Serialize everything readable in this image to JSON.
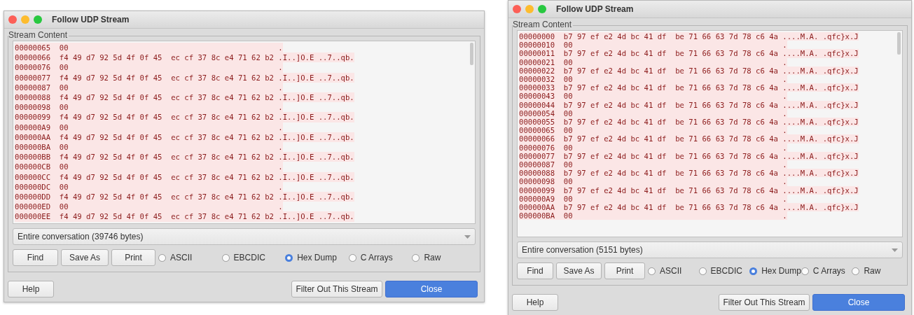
{
  "windows": [
    {
      "title": "Follow UDP Stream",
      "group_label": "Stream Content",
      "lines": [
        "00000065  00                                               .",
        "00000066  f4 49 d7 92 5d 4f 0f 45  ec cf 37 8c e4 71 62 b2 .I..]O.E ..7..qb.",
        "00000076  00                                               .",
        "00000077  f4 49 d7 92 5d 4f 0f 45  ec cf 37 8c e4 71 62 b2 .I..]O.E ..7..qb.",
        "00000087  00                                               .",
        "00000088  f4 49 d7 92 5d 4f 0f 45  ec cf 37 8c e4 71 62 b2 .I..]O.E ..7..qb.",
        "00000098  00                                               .",
        "00000099  f4 49 d7 92 5d 4f 0f 45  ec cf 37 8c e4 71 62 b2 .I..]O.E ..7..qb.",
        "000000A9  00                                               .",
        "000000AA  f4 49 d7 92 5d 4f 0f 45  ec cf 37 8c e4 71 62 b2 .I..]O.E ..7..qb.",
        "000000BA  00                                               .",
        "000000BB  f4 49 d7 92 5d 4f 0f 45  ec cf 37 8c e4 71 62 b2 .I..]O.E ..7..qb.",
        "000000CB  00                                               .",
        "000000CC  f4 49 d7 92 5d 4f 0f 45  ec cf 37 8c e4 71 62 b2 .I..]O.E ..7..qb.",
        "000000DC  00                                               .",
        "000000DD  f4 49 d7 92 5d 4f 0f 45  ec cf 37 8c e4 71 62 b2 .I..]O.E ..7..qb.",
        "000000ED  00                                               .",
        "000000EE  f4 49 d7 92 5d 4f 0f 45  ec cf 37 8c e4 71 62 b2 .I..]O.E ..7..qb."
      ],
      "conversation": "Entire conversation (39746 bytes)",
      "actions": [
        "Find",
        "Save As",
        "Print"
      ],
      "formats": [
        {
          "label": "ASCII",
          "selected": false
        },
        {
          "label": "EBCDIC",
          "selected": false
        },
        {
          "label": "Hex Dump",
          "selected": true
        },
        {
          "label": "C Arrays",
          "selected": false
        },
        {
          "label": "Raw",
          "selected": false
        }
      ],
      "footer": [
        {
          "label": "Help",
          "kind": "default"
        },
        {
          "label": "Filter Out This Stream",
          "kind": "default"
        },
        {
          "label": "Close",
          "kind": "primary"
        }
      ]
    },
    {
      "title": "Follow UDP Stream",
      "group_label": "Stream Content",
      "lines": [
        "00000000  b7 97 ef e2 4d bc 41 df  be 71 66 63 7d 78 c6 4a ....M.A. .qfc}x.J",
        "00000010  00                                               .",
        "00000011  b7 97 ef e2 4d bc 41 df  be 71 66 63 7d 78 c6 4a ....M.A. .qfc}x.J",
        "00000021  00                                               .",
        "00000022  b7 97 ef e2 4d bc 41 df  be 71 66 63 7d 78 c6 4a ....M.A. .qfc}x.J",
        "00000032  00                                               .",
        "00000033  b7 97 ef e2 4d bc 41 df  be 71 66 63 7d 78 c6 4a ....M.A. .qfc}x.J",
        "00000043  00                                               .",
        "00000044  b7 97 ef e2 4d bc 41 df  be 71 66 63 7d 78 c6 4a ....M.A. .qfc}x.J",
        "00000054  00                                               .",
        "00000055  b7 97 ef e2 4d bc 41 df  be 71 66 63 7d 78 c6 4a ....M.A. .qfc}x.J",
        "00000065  00                                               .",
        "00000066  b7 97 ef e2 4d bc 41 df  be 71 66 63 7d 78 c6 4a ....M.A. .qfc}x.J",
        "00000076  00                                               .",
        "00000077  b7 97 ef e2 4d bc 41 df  be 71 66 63 7d 78 c6 4a ....M.A. .qfc}x.J",
        "00000087  00                                               .",
        "00000088  b7 97 ef e2 4d bc 41 df  be 71 66 63 7d 78 c6 4a ....M.A. .qfc}x.J",
        "00000098  00                                               .",
        "00000099  b7 97 ef e2 4d bc 41 df  be 71 66 63 7d 78 c6 4a ....M.A. .qfc}x.J",
        "000000A9  00                                               .",
        "000000AA  b7 97 ef e2 4d bc 41 df  be 71 66 63 7d 78 c6 4a ....M.A. .qfc}x.J",
        "000000BA  00                                               ."
      ],
      "conversation": "Entire conversation (5151 bytes)",
      "actions": [
        "Find",
        "Save As",
        "Print"
      ],
      "formats": [
        {
          "label": "ASCII",
          "selected": false
        },
        {
          "label": "EBCDIC",
          "selected": false
        },
        {
          "label": "Hex Dump",
          "selected": true
        },
        {
          "label": "C Arrays",
          "selected": false
        },
        {
          "label": "Raw",
          "selected": false
        }
      ],
      "footer": [
        {
          "label": "Help",
          "kind": "default"
        },
        {
          "label": "Filter Out This Stream",
          "kind": "default"
        },
        {
          "label": "Close",
          "kind": "primary"
        }
      ]
    }
  ]
}
